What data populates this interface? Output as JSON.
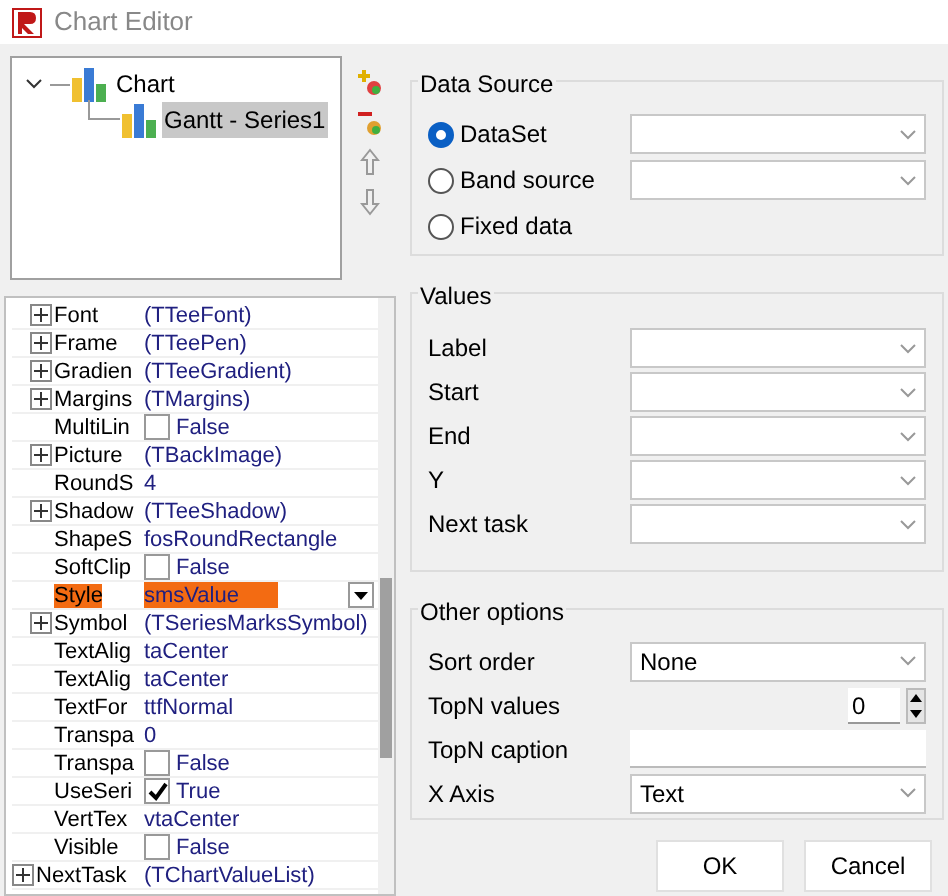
{
  "window": {
    "title": "Chart Editor"
  },
  "series_tree": [
    {
      "label": "Chart",
      "expanded": true,
      "selected": false,
      "children": [
        {
          "label": "Gantt - Series1",
          "selected": true
        }
      ]
    }
  ],
  "property_rows": [
    {
      "children": [
        {
          "name": "Font",
          "kind": "object",
          "value": "(TTeeFont)"
        },
        {
          "name": "Frame",
          "kind": "object",
          "value": "(TTeePen)"
        },
        {
          "name": "Gradien",
          "kind": "object",
          "value": "(TTeeGradient)"
        },
        {
          "name": "Margins",
          "kind": "object",
          "value": "(TMargins)"
        },
        {
          "name": "MultiLin",
          "kind": "bool",
          "checked": false,
          "value": "False"
        },
        {
          "name": "Picture",
          "kind": "object",
          "value": "(TBackImage)"
        },
        {
          "name": "RoundS",
          "kind": "text",
          "value": "4"
        },
        {
          "name": "Shadow",
          "kind": "object",
          "value": "(TTeeShadow)"
        },
        {
          "name": "ShapeS",
          "kind": "text",
          "value": "fosRoundRectangle"
        },
        {
          "name": "SoftClip",
          "kind": "bool",
          "checked": false,
          "value": "False"
        },
        {
          "name": "Style",
          "kind": "dropdown",
          "selected": true,
          "value": "smsValue"
        },
        {
          "name": "Symbol",
          "kind": "object",
          "value": "(TSeriesMarksSymbol)"
        },
        {
          "name": "TextAlig",
          "kind": "text",
          "value": "taCenter"
        },
        {
          "name": "TextAlig",
          "kind": "text",
          "value": "taCenter"
        },
        {
          "name": "TextFor",
          "kind": "text",
          "value": "ttfNormal"
        },
        {
          "name": "Transpa",
          "kind": "text",
          "value": "0"
        },
        {
          "name": "Transpa",
          "kind": "bool",
          "checked": false,
          "value": "False"
        },
        {
          "name": "UseSeri",
          "kind": "bool",
          "checked": true,
          "value": "True"
        },
        {
          "name": "VertTex",
          "kind": "text",
          "value": "vtaCenter"
        },
        {
          "name": "Visible",
          "kind": "bool",
          "checked": false,
          "value": "False"
        }
      ]
    },
    {
      "name": "NextTask",
      "kind": "object",
      "value": "(TChartValueList)"
    }
  ],
  "data_source": {
    "title": "Data Source",
    "options": [
      {
        "label": "DataSet",
        "selected": true,
        "has_combo": true
      },
      {
        "label": "Band source",
        "selected": false,
        "has_combo": true
      },
      {
        "label": "Fixed data",
        "selected": false,
        "has_combo": false
      }
    ]
  },
  "values": {
    "title": "Values",
    "fields": [
      {
        "label": "Label"
      },
      {
        "label": "Start"
      },
      {
        "label": "End"
      },
      {
        "label": "Y"
      },
      {
        "label": "Next task"
      }
    ]
  },
  "other_options": {
    "title": "Other options",
    "fields": [
      {
        "label": "Sort order",
        "kind": "combo",
        "value": "None"
      },
      {
        "label": "TopN values",
        "kind": "spin",
        "value": "0"
      },
      {
        "label": "TopN caption",
        "kind": "text"
      },
      {
        "label": "X Axis",
        "kind": "combo",
        "value": "Text"
      }
    ]
  },
  "buttons": [
    "OK",
    "Cancel"
  ]
}
